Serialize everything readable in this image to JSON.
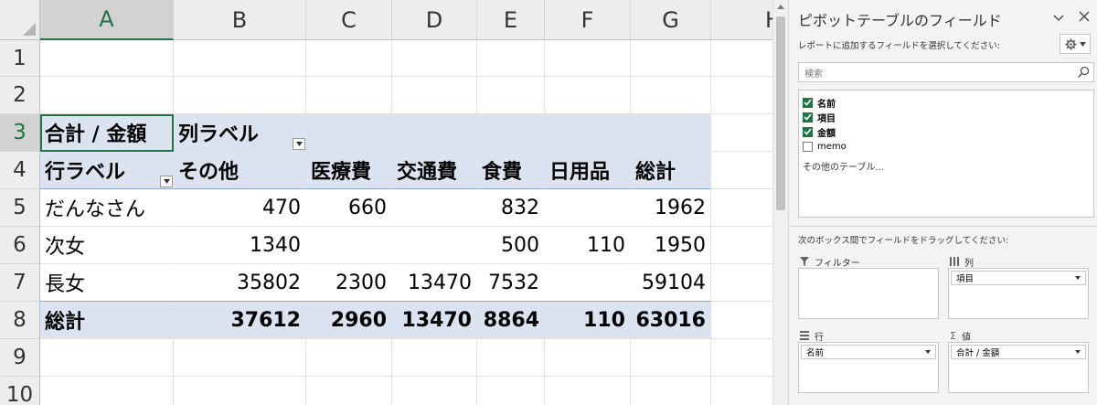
{
  "sheet": {
    "columns": [
      "A",
      "B",
      "C",
      "D",
      "E",
      "F",
      "G",
      "H"
    ],
    "rows": [
      "1",
      "2",
      "3",
      "4",
      "5",
      "6",
      "7",
      "8",
      "9",
      "10"
    ],
    "pivot": {
      "values_label": "合計 / 金額",
      "column_labels": "列ラベル",
      "row_labels": "行ラベル",
      "headers": [
        "その他",
        "医療費",
        "交通費",
        "食費",
        "日用品",
        "総計"
      ],
      "body": [
        {
          "label": "だんなさん",
          "values": [
            "470",
            "660",
            "",
            "832",
            "",
            "1962"
          ]
        },
        {
          "label": "次女",
          "values": [
            "1340",
            "",
            "",
            "500",
            "110",
            "1950"
          ]
        },
        {
          "label": "長女",
          "values": [
            "35802",
            "2300",
            "13470",
            "7532",
            "",
            "59104"
          ]
        }
      ],
      "total": {
        "label": "総計",
        "values": [
          "37612",
          "2960",
          "13470",
          "8864",
          "110",
          "63016"
        ]
      }
    }
  },
  "pane": {
    "title": "ピボットテーブルのフィールド",
    "subtitle": "レポートに追加するフィールドを選択してください:",
    "search_placeholder": "検索",
    "fields": [
      {
        "label": "名前",
        "checked": true
      },
      {
        "label": "項目",
        "checked": true
      },
      {
        "label": "金額",
        "checked": true
      },
      {
        "label": "memo",
        "checked": false
      }
    ],
    "more_tables": "その他のテーブル...",
    "drag_hint": "次のボックス間でフィールドをドラッグしてください:",
    "areas": {
      "filter": {
        "label": "フィルター"
      },
      "columns": {
        "label": "列",
        "item": "項目"
      },
      "rows": {
        "label": "行",
        "item": "名前"
      },
      "values": {
        "label": "値",
        "item": "合計 / 金額"
      }
    }
  }
}
